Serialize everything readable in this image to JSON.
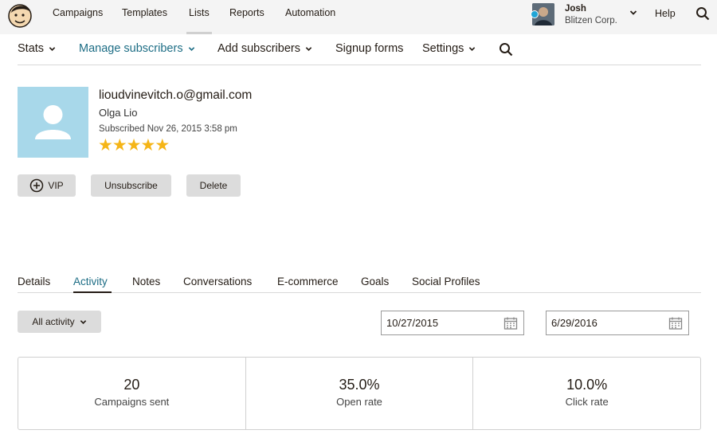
{
  "topnav": {
    "items": [
      "Campaigns",
      "Templates",
      "Lists",
      "Reports",
      "Automation"
    ],
    "user_name": "Josh",
    "user_org": "Blitzen Corp.",
    "help": "Help"
  },
  "subnav": {
    "items": [
      "Stats",
      "Manage subscribers",
      "Add subscribers",
      "Signup forms",
      "Settings"
    ]
  },
  "profile": {
    "email": "lioudvinevitch.o@gmail.com",
    "name": "Olga Lio",
    "subscribed": "Subscribed Nov 26, 2015 3:58 pm",
    "rating": 5
  },
  "actions": {
    "vip": "VIP",
    "unsubscribe": "Unsubscribe",
    "delete": "Delete"
  },
  "tabs": [
    "Details",
    "Activity",
    "Notes",
    "Conversations",
    "E-commerce",
    "Goals",
    "Social Profiles"
  ],
  "filters": {
    "activity": "All activity",
    "start_date": "10/27/2015",
    "end_date": "6/29/2016"
  },
  "stats": [
    {
      "value": "20",
      "label": "Campaigns sent"
    },
    {
      "value": "35.0%",
      "label": "Open rate"
    },
    {
      "value": "10.0%",
      "label": "Click rate"
    }
  ],
  "colors": {
    "accent": "#1d6d85",
    "star": "#f5b517",
    "avatar_bg": "#a8d8ea"
  }
}
